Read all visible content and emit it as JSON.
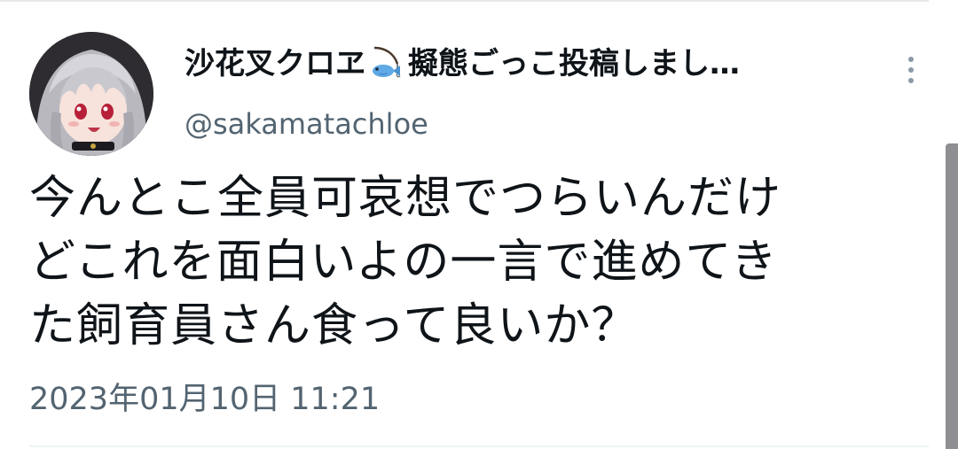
{
  "tweet": {
    "display_name_prefix": "沙花叉クロヱ",
    "display_name_suffix": "擬態ごっこ投稿しまし…",
    "name_emoji": "fishing-fish-emoji",
    "handle": "@sakamatachloe",
    "text": "今んとこ全員可哀想でつらいんだけ\nどこれを面白いよの一言で進めてき\nた飼育員さん食って良いか？",
    "timestamp": "2023年01月10日 11:21"
  },
  "icons": {
    "more": "vertical-ellipsis-icon",
    "avatar": "user-avatar"
  },
  "colors": {
    "text_primary": "#0f1419",
    "text_secondary": "#536471",
    "divider": "#e7e9ea",
    "scrollbar": "#8e8e93"
  }
}
